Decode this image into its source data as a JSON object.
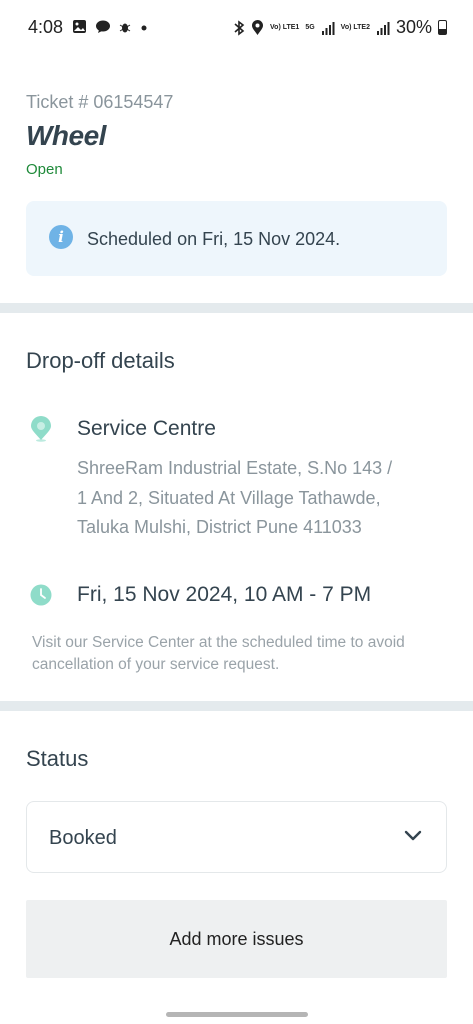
{
  "status_bar": {
    "time": "4:08",
    "battery": "30%",
    "network_1": "Vo) LTE1",
    "network_5g": "5G",
    "network_2": "Vo) LTE2"
  },
  "ticket": {
    "number_label": "Ticket # 06154547",
    "title": "Wheel",
    "status": "Open",
    "status_color": "#1f8a3a",
    "schedule_text": "Scheduled on Fri, 15 Nov 2024."
  },
  "dropoff": {
    "heading": "Drop-off details",
    "centre_name": "Service Centre",
    "address": "ShreeRam Industrial Estate, S.No 143 / 1 And 2, Situated At Village Tathawde, Taluka Mulshi, District Pune 411033",
    "slot": "Fri, 15 Nov 2024, 10 AM - 7 PM",
    "note": "Visit our Service Center at the scheduled time to avoid cancellation of your service request."
  },
  "status_section": {
    "heading": "Status",
    "selected": "Booked"
  },
  "actions": {
    "add_more_issues": "Add more issues"
  },
  "colors": {
    "accent_teal": "#8fdcc9",
    "info_blue": "#6fb3e6",
    "info_bg": "#eef6fc",
    "divider": "#e4eaed"
  }
}
